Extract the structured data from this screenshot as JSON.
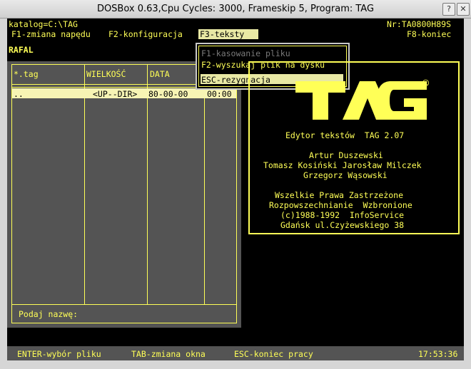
{
  "window": {
    "title": "DOSBox 0.63,Cpu Cycles:      3000, Frameskip  5, Program:      TAG",
    "buttons": {
      "help": "?",
      "close": "✕"
    }
  },
  "top": {
    "path": "katalog=C:\\TAG",
    "serial": "Nr:TA0800H89S",
    "menu_f1": "F1-zmiana napędu",
    "menu_f2": "F2-konfiguracja",
    "menu_f3": "F3-teksty",
    "menu_f8": "F8-koniec"
  },
  "user": "RAFAL",
  "popup": {
    "items": [
      {
        "label": "F1-kasowanie pliku",
        "state": "disabled"
      },
      {
        "label": "F2-wyszukaj plik na dysku",
        "state": "normal"
      },
      {
        "label": "ESC-rezygnacja",
        "state": "selected"
      }
    ]
  },
  "file_list": {
    "columns": [
      "*.tag",
      "WIELKOŚĆ",
      "DATA",
      ""
    ],
    "rows": [
      {
        "name": "..",
        "size": "<UP--DIR>",
        "date": "80-00-00",
        "time": "00:00"
      }
    ],
    "prompt": "Podaj nazwę:"
  },
  "about": {
    "logo_text": "TAG",
    "registered": "®",
    "lines": [
      "Edytor tekstów  TAG 2.07",
      "Artur Duszewski",
      "Tomasz Kosiński Jarosław Milczek",
      "Grzegorz Wąsowski",
      "Wszelkie Prawa Zastrzeżone",
      "Rozpowszechnianie  Wzbronione",
      "(c)1988-1992  InfoService",
      "Gdańsk ul.Czyżewskiego 38"
    ]
  },
  "status": {
    "enter": "ENTER-wybór pliku",
    "tab": "TAB-zmiana okna",
    "esc": "ESC-koniec pracy",
    "clock": "17:53:36"
  },
  "colors": {
    "accent": "#ffff57",
    "panel": "#545454",
    "highlight": "#e8e8a4"
  }
}
